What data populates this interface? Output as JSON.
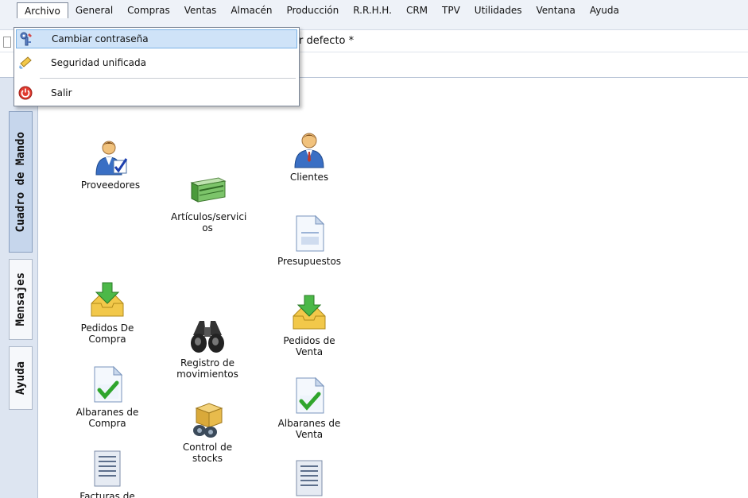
{
  "menu": {
    "items": [
      "Archivo",
      "General",
      "Compras",
      "Ventas",
      "Almacén",
      "Producción",
      "R.R.H.H.",
      "CRM",
      "TPV",
      "Utilidades",
      "Ventana",
      "Ayuda"
    ],
    "active": "Archivo"
  },
  "dropdown": {
    "items": [
      {
        "label": "Cambiar contraseña",
        "icon": "key-icon",
        "highlighted": true
      },
      {
        "label": "Seguridad unificada",
        "icon": "shield-icon",
        "highlighted": false
      },
      {
        "label": "Salir",
        "icon": "power-icon",
        "highlighted": false
      }
    ]
  },
  "toolbar": {
    "doc_title": "r defecto *"
  },
  "left_tabs": [
    "Cuadro de Mando",
    "Mensajes",
    "Ayuda"
  ],
  "shortcuts": {
    "proveedores": "Proveedores",
    "clientes": "Clientes",
    "articulos_1": "Artículos/servici",
    "articulos_2": "os",
    "presupuestos": "Presupuestos",
    "pedidos_compra_1": "Pedidos De",
    "pedidos_compra_2": "Compra",
    "registro_1": "Registro de",
    "registro_2": "movimientos",
    "pedidos_venta_1": "Pedidos de",
    "pedidos_venta_2": "Venta",
    "albaranes_compra_1": "Albaranes de",
    "albaranes_compra_2": "Compra",
    "control_stocks_1": "Control de",
    "control_stocks_2": "stocks",
    "albaranes_venta_1": "Albaranes de",
    "albaranes_venta_2": "Venta",
    "facturas_1": "Facturas de"
  },
  "colors": {
    "menubar": "#eef2f8",
    "highlight": "#cfe3f8",
    "left_panel": "#dde5f1"
  }
}
